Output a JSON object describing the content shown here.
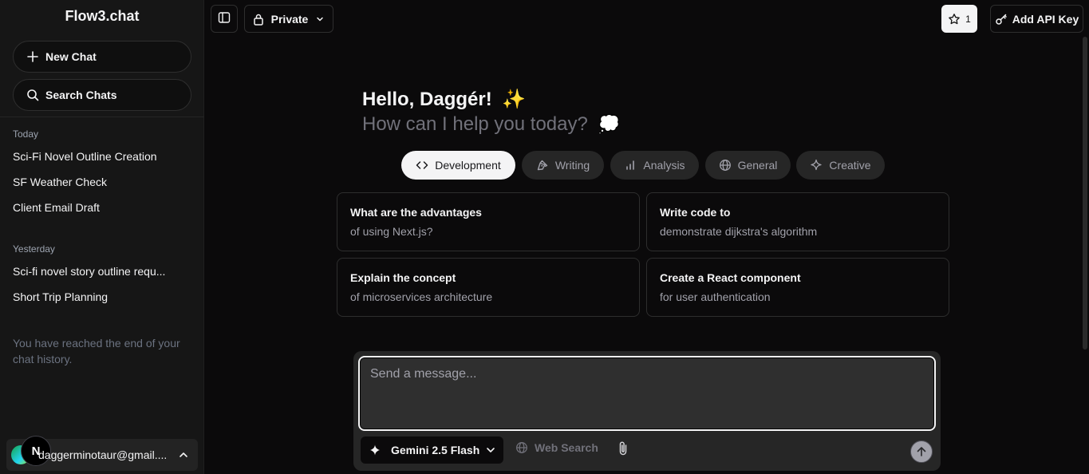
{
  "app": {
    "title": "Flow3.chat"
  },
  "sidebar": {
    "new_chat": "New Chat",
    "search_chats": "Search Chats",
    "groups": [
      {
        "label": "Today",
        "items": [
          "Sci-Fi Novel Outline Creation",
          "SF Weather Check",
          "Client Email Draft"
        ]
      },
      {
        "label": "Yesterday",
        "items": [
          "Sci-fi novel story outline requ...",
          "Short Trip Planning"
        ]
      }
    ],
    "end_message": "You have reached the end of your chat history.",
    "account": {
      "avatar_letter": "N",
      "email": "daggerminotaur@gmail...."
    }
  },
  "header": {
    "visibility": "Private",
    "star_count": "1",
    "add_api_key": "Add API Key"
  },
  "main": {
    "greeting": "Hello, Daggér!",
    "greeting_emoji": "✨",
    "subgreeting": "How can I help you today?",
    "subgreeting_emoji": "💭",
    "tabs": [
      {
        "label": "Development",
        "icon": "code-icon",
        "active": true
      },
      {
        "label": "Writing",
        "icon": "pen-tool-icon",
        "active": false
      },
      {
        "label": "Analysis",
        "icon": "bar-chart-icon",
        "active": false
      },
      {
        "label": "General",
        "icon": "globe-icon",
        "active": false
      },
      {
        "label": "Creative",
        "icon": "sparkle-icon",
        "active": false
      }
    ],
    "suggestions": [
      {
        "title": "What are the advantages",
        "subtitle": "of using Next.js?"
      },
      {
        "title": "Write code to",
        "subtitle": "demonstrate dijkstra's algorithm"
      },
      {
        "title": "Explain the concept",
        "subtitle": "of microservices architecture"
      },
      {
        "title": "Create a React component",
        "subtitle": "for user authentication"
      }
    ]
  },
  "composer": {
    "placeholder": "Send a message...",
    "model": "Gemini 2.5 Flash",
    "web_search": "Web Search"
  },
  "colors": {
    "background": "#0b0a0b",
    "sidebar": "#161616",
    "accent": "#f4f4f5",
    "muted": "#a1a1aa"
  }
}
